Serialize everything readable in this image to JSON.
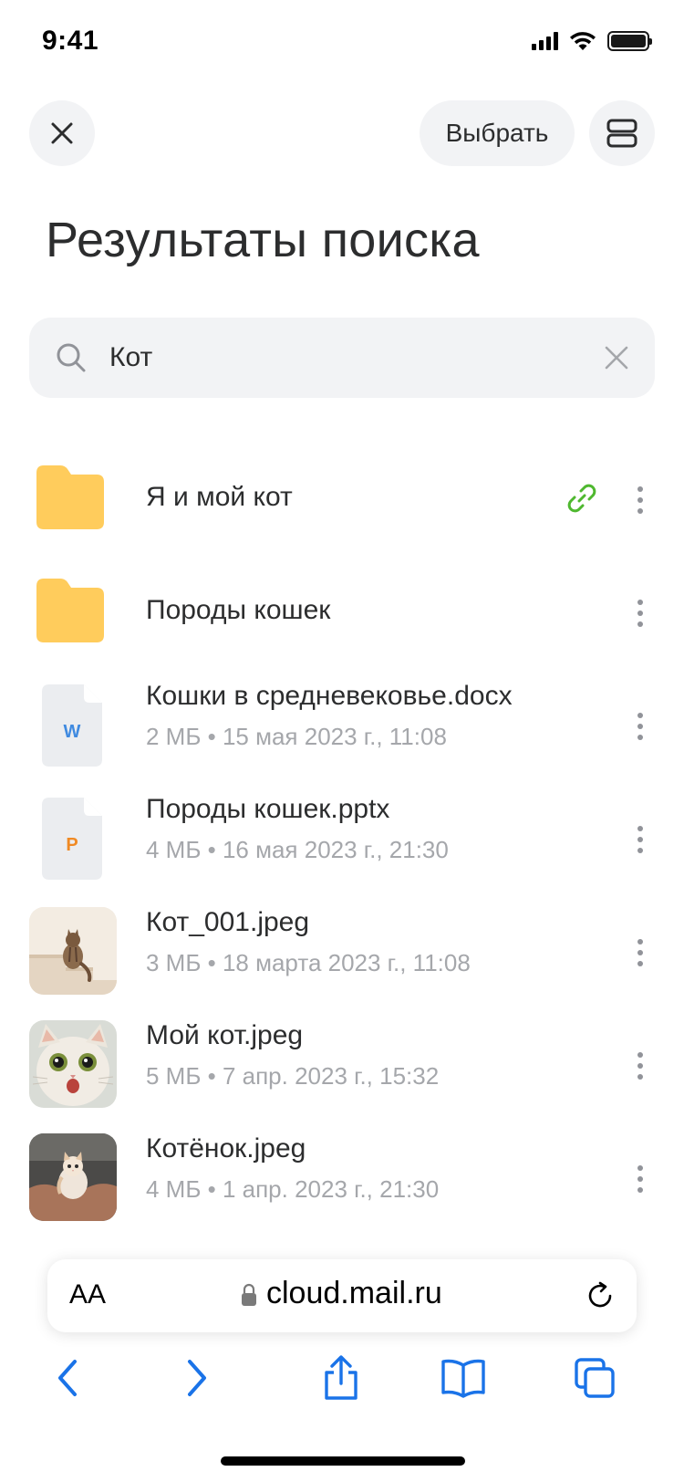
{
  "status_bar": {
    "time": "9:41"
  },
  "header": {
    "select_label": "Выбрать",
    "title": "Результаты поиска"
  },
  "search": {
    "value": "Кот"
  },
  "files": [
    {
      "name": "Я и мой кот",
      "type": "folder",
      "shared": true
    },
    {
      "name": "Породы кошек",
      "type": "folder",
      "shared": false
    },
    {
      "name": "Кошки в средневековье.docx",
      "type": "docx",
      "badge": "W",
      "meta": "2 МБ • 15 мая 2023 г., 11:08"
    },
    {
      "name": "Породы кошек.pptx",
      "type": "pptx",
      "badge": "P",
      "meta": "4 МБ • 16 мая 2023 г., 21:30"
    },
    {
      "name": "Кот_001.jpeg",
      "type": "image",
      "meta": "3 МБ • 18 марта 2023 г., 11:08"
    },
    {
      "name": "Мой кот.jpeg",
      "type": "image",
      "meta": "5 МБ • 7 апр. 2023 г., 15:32"
    },
    {
      "name": "Котёнок.jpeg",
      "type": "image",
      "meta": "4 МБ • 1 апр. 2023 г., 21:30"
    }
  ],
  "browser": {
    "text_size_label": "AA",
    "url": "cloud.mail.ru"
  },
  "colors": {
    "folder": "#ffcc5c",
    "link": "#4fb82f",
    "docx_badge": "#3f8ae0",
    "pptx_badge": "#f08a24",
    "accent": "#1a73e8",
    "meta_text": "#a5a7ab"
  }
}
